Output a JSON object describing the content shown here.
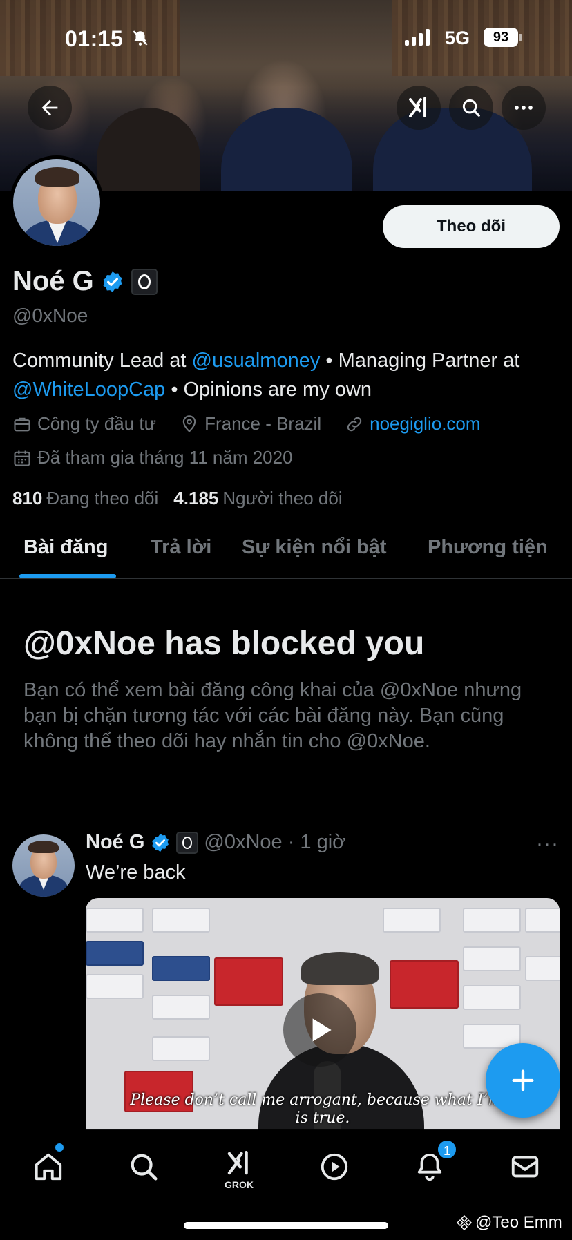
{
  "status_bar": {
    "time": "01:15",
    "network": "5G",
    "battery": "93"
  },
  "profile": {
    "name": "Noé G",
    "handle": "@0xNoe",
    "follow_label": "Theo dõi",
    "bio": {
      "part1": "Community Lead at ",
      "mention1": "@usualmoney",
      "part2": " • Managing Partner at ",
      "mention2": "@WhiteLoopCap",
      "part3": " • Opinions are my own"
    },
    "category": "Công ty đầu tư",
    "location": "France - Brazil",
    "website": "noegiglio.com",
    "joined": "Đã tham gia tháng 11 năm 2020",
    "following_count": "810",
    "following_label": "Đang theo dõi",
    "followers_count": "4.185",
    "followers_label": "Người theo dõi"
  },
  "tabs": [
    {
      "label": "Bài đăng",
      "active": true
    },
    {
      "label": "Trả lời"
    },
    {
      "label": "Sự kiện nổi bật"
    },
    {
      "label": "Phương tiện"
    }
  ],
  "blocked": {
    "title": "@0xNoe has blocked you",
    "text": "Bạn có thể xem bài đăng công khai của @0xNoe nhưng bạn bị chặn tương tác với các bài đăng này. Bạn cũng không thể theo dõi hay nhắn tin cho @0xNoe."
  },
  "post": {
    "name": "Noé G",
    "handle": "@0xNoe",
    "time": "· 1 giờ",
    "more": "···",
    "text": "We’re back",
    "subtitle_line1": "Please don’t call me arrogant, because what I’m s",
    "subtitle_line2": "is true."
  },
  "bottom_nav": {
    "grok_label": "GROK",
    "notifications_badge": "1"
  },
  "watermark": "@Teo Emm",
  "colors": {
    "accent": "#1d9bf0",
    "background": "#000000",
    "muted": "#71767b"
  },
  "icons": [
    "back-arrow-icon",
    "grok-icon",
    "search-icon",
    "more-icon",
    "verified-badge-icon",
    "briefcase-icon",
    "location-icon",
    "link-icon",
    "calendar-icon",
    "play-icon",
    "compose-plus-icon",
    "home-icon",
    "play-circle-icon",
    "bell-icon",
    "mail-icon"
  ]
}
